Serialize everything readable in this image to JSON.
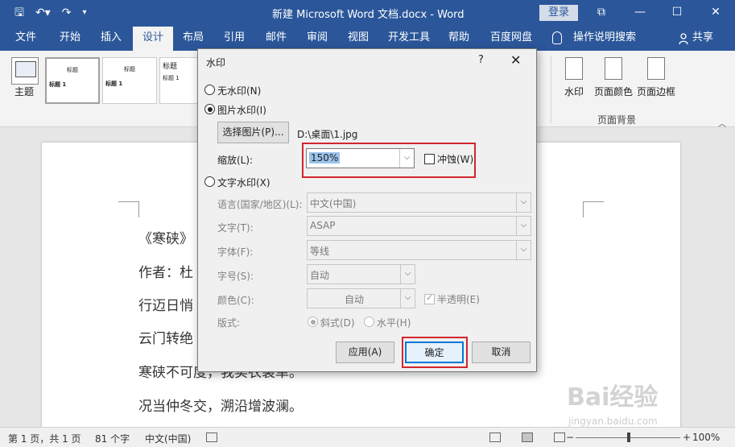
{
  "titlebar": {
    "title": "新建 Microsoft Word 文档.docx  -  Word",
    "login": "登录"
  },
  "tabs": [
    "文件",
    "开始",
    "插入",
    "设计",
    "布局",
    "引用",
    "邮件",
    "审阅",
    "视图",
    "开发工具",
    "帮助",
    "百度网盘"
  ],
  "active_tab": "设计",
  "tell_me": "操作说明搜索",
  "share": "共享",
  "ribbon": {
    "theme": "主题",
    "thumbs": [
      {
        "title": "标题",
        "heading": "标题 1"
      },
      {
        "title": "标题",
        "heading": "标题 1"
      },
      {
        "title": "标题",
        "heading": "标题 1"
      }
    ],
    "watermark": "水印",
    "page_color": "页面颜色",
    "page_border": "页面边框",
    "group": "页面背景"
  },
  "document": {
    "lines": [
      "《寒硖》",
      "作者：杜",
      "行迈日悄",
      "云门转绝",
      "寒硖不可度，我实衣裳单。",
      "况当仲冬交，溯沿增波澜。"
    ]
  },
  "dialog": {
    "title": "水印",
    "help": "?",
    "no_watermark": "无水印(N)",
    "picture_watermark": "图片水印(I)",
    "select_picture": "选择图片(P)...",
    "picture_path": "D:\\桌面\\1.jpg",
    "scale_label": "缩放(L):",
    "scale_value": "150%",
    "washout": "冲蚀(W)",
    "text_watermark": "文字水印(X)",
    "language_label": "语言(国家/地区)(L):",
    "language_value": "中文(中国)",
    "text_label": "文字(T):",
    "text_value": "ASAP",
    "font_label": "字体(F):",
    "font_value": "等线",
    "size_label": "字号(S):",
    "size_value": "自动",
    "color_label": "颜色(C):",
    "color_value": "自动",
    "semitransparent": "半透明(E)",
    "layout_label": "版式:",
    "diagonal": "斜式(D)",
    "horizontal": "水平(H)",
    "apply": "应用(A)",
    "ok": "确定",
    "cancel": "取消"
  },
  "statusbar": {
    "page": "第 1 页，共 1 页",
    "words": "81 个字",
    "language": "中文(中国)",
    "zoom": "100%"
  },
  "watermark_overlay": {
    "brand": "Bai经验",
    "url": "jingyan.baidu.com"
  },
  "colors": {
    "word_blue": "#2b579a",
    "highlight_red": "#d2262c"
  }
}
